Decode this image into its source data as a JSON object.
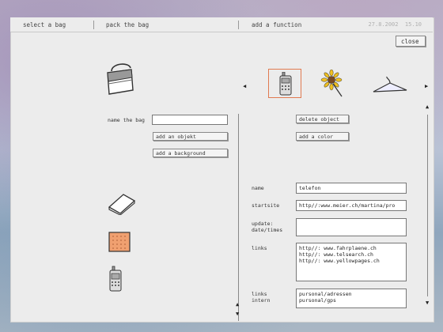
{
  "header": {
    "tabs": [
      "select a bag",
      "pack the bag",
      "add a function"
    ],
    "date": "27.8.2002",
    "time": "15.10"
  },
  "close_label": "close",
  "left": {
    "name_label": "name the bag",
    "name_value": "",
    "add_object_label": "add an objekt",
    "add_background_label": "add a background"
  },
  "right": {
    "delete_object_label": "delete object",
    "add_color_label": "add a color",
    "fields": {
      "name_label": "name",
      "name_value": "telefon",
      "startsite_label": "startsite",
      "startsite_value": "http//:www.meier.ch/martina/pro",
      "update_label_1": "update:",
      "update_label_2": "date/times",
      "update_value": "",
      "links_label": "links",
      "links": [
        "http//: www.fahrplaene.ch",
        "http//: www.telsearch.ch",
        "http//: www.yellowpages.ch"
      ],
      "links_intern_label_1": "links",
      "links_intern_label_2": "intern",
      "links_intern": [
        "pursonal/adressen",
        "pursonal/gps"
      ]
    }
  },
  "icons": {
    "bag": "bag-icon",
    "notebook": "notebook-icon",
    "cracker": "cracker-icon",
    "phone": "phone-icon",
    "sunflower": "sunflower-icon",
    "hanger": "hanger-icon"
  },
  "colors": {
    "selected_border": "#e07a50",
    "cracker_fill": "#f0a070"
  }
}
